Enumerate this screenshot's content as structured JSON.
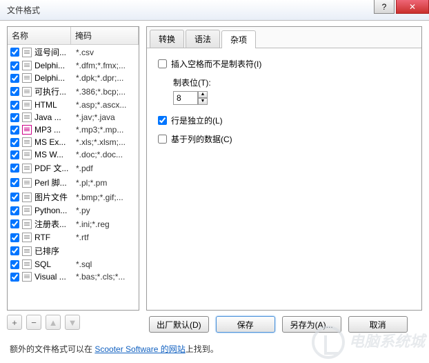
{
  "window": {
    "title": "文件格式"
  },
  "list": {
    "col_name": "名称",
    "col_mask": "掩码",
    "items": [
      {
        "checked": true,
        "icon": "grid",
        "name": "逗号间...",
        "mask": "*.csv"
      },
      {
        "checked": true,
        "icon": "file",
        "name": "Delphi...",
        "mask": "*.dfm;*.fmx;..."
      },
      {
        "checked": true,
        "icon": "file",
        "name": "Delphi...",
        "mask": "*.dpk;*.dpr;..."
      },
      {
        "checked": true,
        "icon": "file",
        "name": "可执行...",
        "mask": "*.386;*.bcp;..."
      },
      {
        "checked": true,
        "icon": "file",
        "name": "HTML",
        "mask": "*.asp;*.ascx..."
      },
      {
        "checked": true,
        "icon": "file",
        "name": "Java ...",
        "mask": "*.jav;*.java"
      },
      {
        "checked": true,
        "icon": "mp3",
        "name": "MP3 ...",
        "mask": "*.mp3;*.mp..."
      },
      {
        "checked": true,
        "icon": "file",
        "name": "MS Ex...",
        "mask": "*.xls;*.xlsm;..."
      },
      {
        "checked": true,
        "icon": "file",
        "name": "MS W...",
        "mask": "*.doc;*.doc..."
      },
      {
        "checked": true,
        "icon": "file",
        "name": "PDF 文...",
        "mask": "*.pdf"
      },
      {
        "checked": true,
        "icon": "file",
        "name": "Perl 脚...",
        "mask": "*.pl;*.pm"
      },
      {
        "checked": true,
        "icon": "file",
        "name": "图片文件",
        "mask": "*.bmp;*.gif;..."
      },
      {
        "checked": true,
        "icon": "file",
        "name": "Python...",
        "mask": "*.py"
      },
      {
        "checked": true,
        "icon": "file",
        "name": "注册表...",
        "mask": "*.ini;*.reg"
      },
      {
        "checked": true,
        "icon": "file",
        "name": "RTF",
        "mask": "*.rtf"
      },
      {
        "checked": true,
        "icon": "file",
        "name": "已排序",
        "mask": ""
      },
      {
        "checked": true,
        "icon": "file",
        "name": "SQL",
        "mask": "*.sql"
      },
      {
        "checked": true,
        "icon": "file",
        "name": "Visual ...",
        "mask": "*.bas;*.cls;*..."
      }
    ]
  },
  "tabs": {
    "t1": "转换",
    "t2": "语法",
    "t3": "杂项",
    "active": "t3"
  },
  "misc": {
    "insert_spaces_label": "插入空格而不是制表符(I)",
    "insert_spaces_checked": false,
    "tabstop_label": "制表位(T):",
    "tabstop_value": "8",
    "lines_independent_label": "行是独立的(L)",
    "lines_independent_checked": true,
    "column_based_label": "基于列的数据(C)",
    "column_based_checked": false
  },
  "buttons": {
    "factory": "出厂默认(D)",
    "save": "保存",
    "saveas": "另存为(A)...",
    "cancel": "取消"
  },
  "toolbar_icons": {
    "add": "+",
    "remove": "−",
    "up": "▲",
    "down": "▼"
  },
  "footer": {
    "prefix": "额外的文件格式可以在 ",
    "link": "Scooter Software 的网站",
    "suffix": "上找到。"
  }
}
